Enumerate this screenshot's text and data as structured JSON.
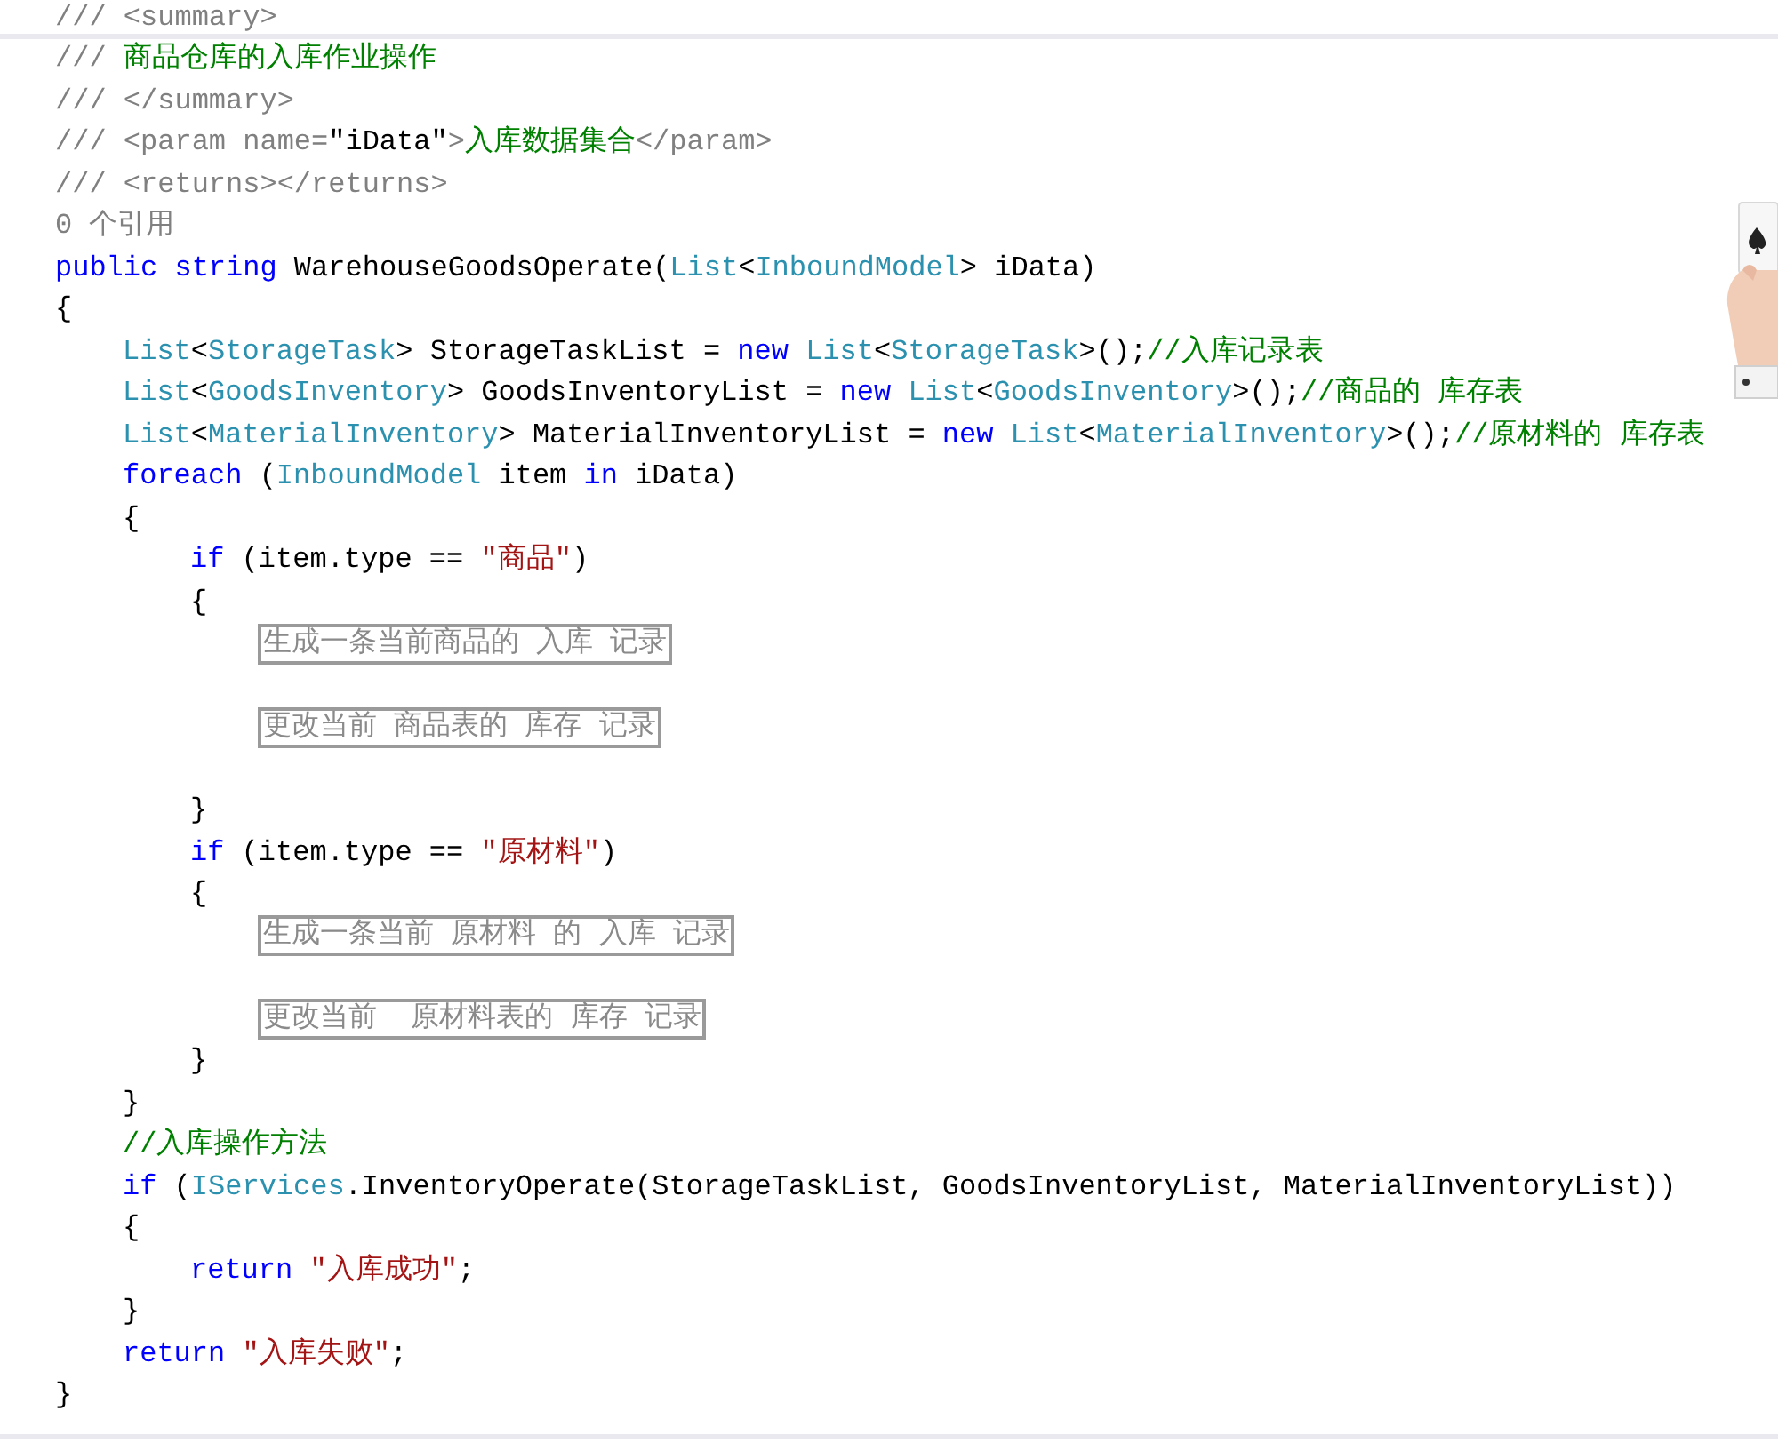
{
  "lines": [
    {
      "tokens": [
        {
          "kind": "doc",
          "text": "/// <summary>"
        }
      ]
    },
    {
      "tokens": [
        {
          "kind": "doc",
          "text": "/// "
        },
        {
          "kind": "comment",
          "text": "商品仓库的入库作业操作"
        }
      ]
    },
    {
      "tokens": [
        {
          "kind": "doc",
          "text": "/// </summary>"
        }
      ]
    },
    {
      "tokens": [
        {
          "kind": "doc",
          "text": "/// <param name="
        },
        {
          "kind": "plain",
          "text": "\"iData\""
        },
        {
          "kind": "doc",
          "text": ">"
        },
        {
          "kind": "comment",
          "text": "入库数据集合"
        },
        {
          "kind": "doc",
          "text": "</param>"
        }
      ]
    },
    {
      "tokens": [
        {
          "kind": "doc",
          "text": "/// <returns></returns>"
        }
      ]
    },
    {
      "tokens": [
        {
          "kind": "codelens",
          "text": "0 个引用"
        }
      ]
    },
    {
      "tokens": [
        {
          "kind": "keyword",
          "text": "public"
        },
        {
          "kind": "keyword",
          "text": " string"
        },
        {
          "kind": "plain",
          "text": " WarehouseGoodsOperate("
        },
        {
          "kind": "type",
          "text": "List"
        },
        {
          "kind": "plain",
          "text": "<"
        },
        {
          "kind": "type",
          "text": "InboundModel"
        },
        {
          "kind": "plain",
          "text": "> iData)"
        }
      ]
    },
    {
      "tokens": [
        {
          "kind": "plain",
          "text": "{"
        }
      ]
    },
    {
      "children": [
        {
          "tokens": [
            {
              "kind": "type",
              "text": "List"
            },
            {
              "kind": "plain",
              "text": "<"
            },
            {
              "kind": "type",
              "text": "StorageTask"
            },
            {
              "kind": "plain",
              "text": "> StorageTaskList = "
            },
            {
              "kind": "keyword",
              "text": "new"
            },
            {
              "kind": "type",
              "text": " List"
            },
            {
              "kind": "plain",
              "text": "<"
            },
            {
              "kind": "type",
              "text": "StorageTask"
            },
            {
              "kind": "plain",
              "text": ">();"
            },
            {
              "kind": "comment",
              "text": "//入库记录表"
            }
          ]
        },
        {
          "tokens": [
            {
              "kind": "type",
              "text": "List"
            },
            {
              "kind": "plain",
              "text": "<"
            },
            {
              "kind": "type",
              "text": "GoodsInventory"
            },
            {
              "kind": "plain",
              "text": "> GoodsInventoryList = "
            },
            {
              "kind": "keyword",
              "text": "new"
            },
            {
              "kind": "type",
              "text": " List"
            },
            {
              "kind": "plain",
              "text": "<"
            },
            {
              "kind": "type",
              "text": "GoodsInventory"
            },
            {
              "kind": "plain",
              "text": ">();"
            },
            {
              "kind": "comment",
              "text": "//商品的 库存表"
            }
          ]
        },
        {
          "tokens": [
            {
              "kind": "type",
              "text": "List"
            },
            {
              "kind": "plain",
              "text": "<"
            },
            {
              "kind": "type",
              "text": "MaterialInventory"
            },
            {
              "kind": "plain",
              "text": "> MaterialInventoryList = "
            },
            {
              "kind": "keyword",
              "text": "new"
            },
            {
              "kind": "type",
              "text": " List"
            },
            {
              "kind": "plain",
              "text": "<"
            },
            {
              "kind": "type",
              "text": "MaterialInventory"
            },
            {
              "kind": "plain",
              "text": ">();"
            },
            {
              "kind": "comment",
              "text": "//原材料的 库存表"
            }
          ]
        },
        {
          "tokens": [
            {
              "kind": "keyword",
              "text": "foreach"
            },
            {
              "kind": "plain",
              "text": " ("
            },
            {
              "kind": "type",
              "text": "InboundModel"
            },
            {
              "kind": "plain",
              "text": " item "
            },
            {
              "kind": "keyword",
              "text": "in"
            },
            {
              "kind": "plain",
              "text": " iData)"
            }
          ]
        },
        {
          "tokens": [
            {
              "kind": "plain",
              "text": "{"
            }
          ]
        },
        {
          "children": [
            {
              "tokens": [
                {
                  "kind": "keyword",
                  "text": "if"
                },
                {
                  "kind": "plain",
                  "text": " (item.type == "
                },
                {
                  "kind": "string",
                  "text": "\"商品\""
                },
                {
                  "kind": "plain",
                  "text": ")"
                }
              ]
            },
            {
              "tokens": [
                {
                  "kind": "plain",
                  "text": "{"
                }
              ]
            },
            {
              "children": [
                {
                  "tokens": [
                    {
                      "kind": "box",
                      "text": "生成一条当前商品的 入库 记录"
                    }
                  ]
                },
                {
                  "kind": "blank"
                },
                {
                  "tokens": [
                    {
                      "kind": "box",
                      "text": "更改当前 商品表的 库存 记录"
                    }
                  ]
                },
                {
                  "kind": "blank"
                }
              ]
            },
            {
              "tokens": [
                {
                  "kind": "plain",
                  "text": "}"
                }
              ]
            },
            {
              "tokens": [
                {
                  "kind": "keyword",
                  "text": "if"
                },
                {
                  "kind": "plain",
                  "text": " (item.type == "
                },
                {
                  "kind": "string",
                  "text": "\"原材料\""
                },
                {
                  "kind": "plain",
                  "text": ")"
                }
              ]
            },
            {
              "tokens": [
                {
                  "kind": "plain",
                  "text": "{"
                }
              ]
            },
            {
              "children": [
                {
                  "tokens": [
                    {
                      "kind": "box",
                      "text": "生成一条当前 原材料 的 入库 记录"
                    }
                  ]
                },
                {
                  "kind": "blank"
                },
                {
                  "tokens": [
                    {
                      "kind": "box",
                      "text": "更改当前  原材料表的 库存 记录"
                    }
                  ]
                }
              ]
            },
            {
              "tokens": [
                {
                  "kind": "plain",
                  "text": "}"
                }
              ]
            }
          ]
        },
        {
          "tokens": [
            {
              "kind": "plain",
              "text": "}"
            }
          ]
        },
        {
          "tokens": [
            {
              "kind": "comment",
              "text": "//入库操作方法"
            }
          ]
        },
        {
          "tokens": [
            {
              "kind": "keyword",
              "text": "if"
            },
            {
              "kind": "plain",
              "text": " ("
            },
            {
              "kind": "type",
              "text": "IServices"
            },
            {
              "kind": "plain",
              "text": ".InventoryOperate(StorageTaskList, GoodsInventoryList, MaterialInventoryList))"
            }
          ]
        },
        {
          "tokens": [
            {
              "kind": "plain",
              "text": "{"
            }
          ]
        },
        {
          "children": [
            {
              "tokens": [
                {
                  "kind": "keyword",
                  "text": "return"
                },
                {
                  "kind": "string",
                  "text": " \"入库成功\""
                },
                {
                  "kind": "plain",
                  "text": ";"
                }
              ]
            }
          ]
        },
        {
          "tokens": [
            {
              "kind": "plain",
              "text": "}"
            }
          ]
        },
        {
          "tokens": [
            {
              "kind": "keyword",
              "text": "return"
            },
            {
              "kind": "string",
              "text": " \"入库失败\""
            },
            {
              "kind": "plain",
              "text": ";"
            }
          ]
        }
      ]
    },
    {
      "tokens": [
        {
          "kind": "plain",
          "text": "}"
        }
      ]
    }
  ]
}
